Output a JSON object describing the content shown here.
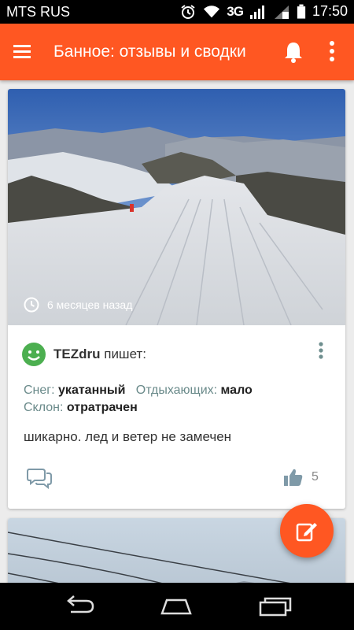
{
  "status_bar": {
    "carrier": "MTS RUS",
    "network": "3G",
    "time": "17:50"
  },
  "app_bar": {
    "title": "Банное: отзывы и сводки",
    "icons": [
      "menu-icon",
      "bell-icon",
      "more-vert-icon"
    ]
  },
  "post": {
    "time_ago": "6 месяцев назад",
    "author": "TEZdru",
    "writes": "пишет:",
    "snow_label": "Снег:",
    "snow_value": "укатанный",
    "visitors_label": "Отдыхающих:",
    "visitors_value": "мало",
    "slope_label": "Склон:",
    "slope_value": "отратрачен",
    "comment": "шикарно. лед и ветер не замечен",
    "likes": "5"
  },
  "colors": {
    "accent": "#ff5722",
    "avatar": "#4caf50"
  }
}
